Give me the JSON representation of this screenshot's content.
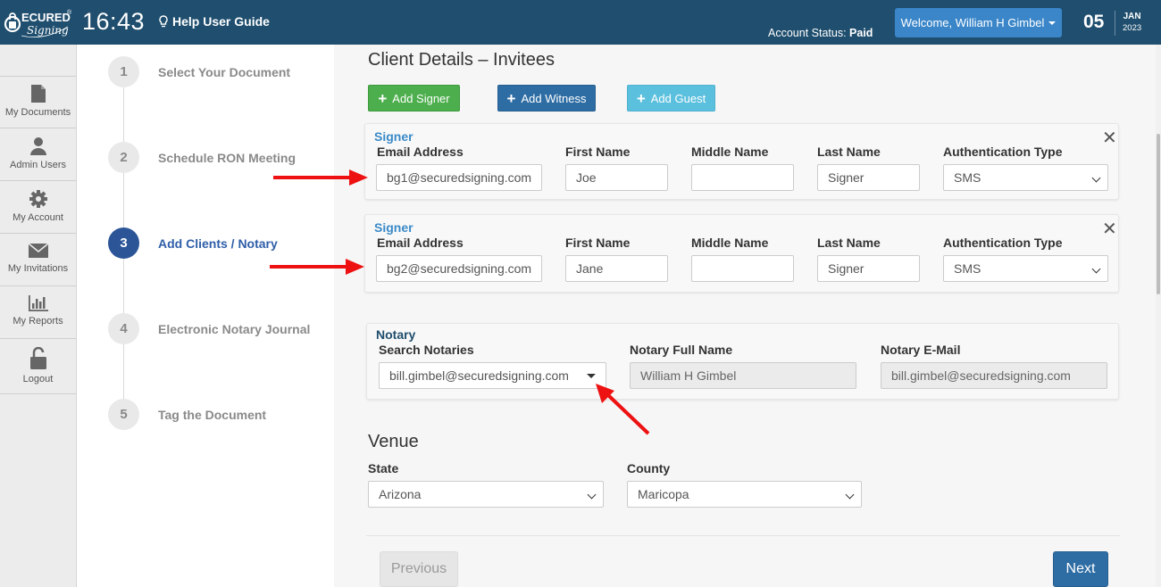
{
  "header": {
    "logo_text": "SECURED Signing",
    "time": "16:43",
    "help_label": "Help User Guide",
    "account_status_label": "Account Status:",
    "account_status_value": "Paid",
    "welcome_label": "Welcome,  William H Gimbel",
    "date_day": "05",
    "date_month": "JAN",
    "date_year": "2023"
  },
  "sidebar": {
    "items": [
      {
        "label": "My Documents",
        "icon": "document-icon"
      },
      {
        "label": "Admin Users",
        "icon": "user-icon"
      },
      {
        "label": "My Account",
        "icon": "gear-icon"
      },
      {
        "label": "My Invitations",
        "icon": "envelope-icon"
      },
      {
        "label": "My Reports",
        "icon": "bar-chart-icon"
      },
      {
        "label": "Logout",
        "icon": "unlock-icon"
      }
    ]
  },
  "steps": [
    {
      "num": "1",
      "label": "Select Your Document",
      "active": false
    },
    {
      "num": "2",
      "label": "Schedule RON Meeting",
      "active": false
    },
    {
      "num": "3",
      "label": "Add Clients / Notary",
      "active": true
    },
    {
      "num": "4",
      "label": "Electronic Notary Journal",
      "active": false
    },
    {
      "num": "5",
      "label": "Tag the Document",
      "active": false
    }
  ],
  "main": {
    "title": "Client Details – Invitees",
    "buttons": {
      "add_signer": "Add Signer",
      "add_witness": "Add Witness",
      "add_guest": "Add Guest"
    },
    "field_labels": {
      "email": "Email Address",
      "first": "First Name",
      "middle": "Middle Name",
      "last": "Last Name",
      "auth": "Authentication Type"
    },
    "signers": [
      {
        "title": "Signer",
        "email": "bg1@securedsigning.com",
        "first": "Joe",
        "middle": "",
        "last": "Signer",
        "auth": "SMS"
      },
      {
        "title": "Signer",
        "email": "bg2@securedsigning.com",
        "first": "Jane",
        "middle": "",
        "last": "Signer",
        "auth": "SMS"
      }
    ],
    "notary": {
      "title": "Notary",
      "search_label": "Search Notaries",
      "search_value": "bill.gimbel@securedsigning.com",
      "fullname_label": "Notary Full Name",
      "fullname_value": "William H Gimbel",
      "email_label": "Notary E-Mail",
      "email_value": "bill.gimbel@securedsigning.com"
    },
    "venue": {
      "title": "Venue",
      "state_label": "State",
      "state_value": "Arizona",
      "county_label": "County",
      "county_value": "Maricopa"
    },
    "previous_label": "Previous",
    "next_label": "Next"
  },
  "colors": {
    "header_bg": "#1f4e6e",
    "accent": "#2e6da4",
    "signer_green": "#4cae4c",
    "guest_blue": "#5bc0de",
    "active_step": "#2b5597",
    "annotation_arrow": "#ee1111"
  }
}
